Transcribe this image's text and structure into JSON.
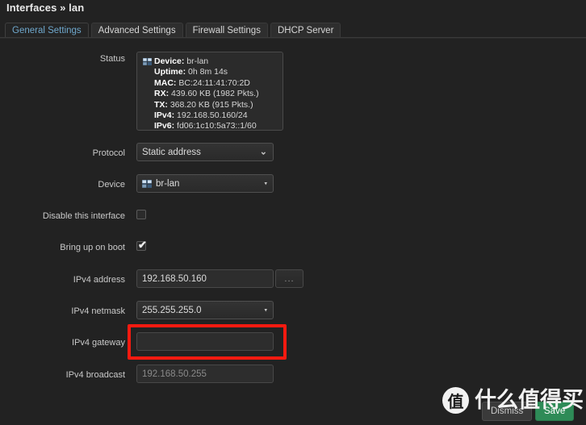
{
  "header": {
    "title": "Interfaces » lan"
  },
  "tabs": [
    {
      "label": "General Settings",
      "active": true
    },
    {
      "label": "Advanced Settings",
      "active": false
    },
    {
      "label": "Firewall Settings",
      "active": false
    },
    {
      "label": "DHCP Server",
      "active": false
    }
  ],
  "form": {
    "status": {
      "label": "Status",
      "icon": "network-bridge-icon",
      "lines": [
        {
          "key": "Device:",
          "value": "br-lan"
        },
        {
          "key": "Uptime:",
          "value": "0h 8m 14s"
        },
        {
          "key": "MAC:",
          "value": "BC:24:11:41:70:2D"
        },
        {
          "key": "RX:",
          "value": "439.60 KB (1982 Pkts.)"
        },
        {
          "key": "TX:",
          "value": "368.20 KB (915 Pkts.)"
        },
        {
          "key": "IPv4:",
          "value": "192.168.50.160/24"
        },
        {
          "key": "IPv6:",
          "value": "fd06:1c10:5a73::1/60"
        }
      ]
    },
    "protocol": {
      "label": "Protocol",
      "value": "Static address",
      "caret": "⌄"
    },
    "device": {
      "label": "Device",
      "value": "br-lan",
      "icon": "network-bridge-icon",
      "caret": "▾"
    },
    "disable_interface": {
      "label": "Disable this interface",
      "checked": false
    },
    "bring_up_on_boot": {
      "label": "Bring up on boot",
      "checked": true,
      "tick": "✔"
    },
    "ipv4_address": {
      "label": "IPv4 address",
      "value": "192.168.50.160",
      "browse_label": "..."
    },
    "ipv4_netmask": {
      "label": "IPv4 netmask",
      "value": "255.255.255.0",
      "caret": "▾"
    },
    "ipv4_gateway": {
      "label": "IPv4 gateway",
      "value": "",
      "placeholder": "",
      "highlight_color": "#f51a10"
    },
    "ipv4_broadcast": {
      "label": "IPv4 broadcast",
      "placeholder": "192.168.50.255",
      "value": ""
    }
  },
  "footer": {
    "dismiss_label": "Dismiss",
    "save_label": "Save"
  },
  "watermark": {
    "logo": "值",
    "text": "什么值得买"
  }
}
